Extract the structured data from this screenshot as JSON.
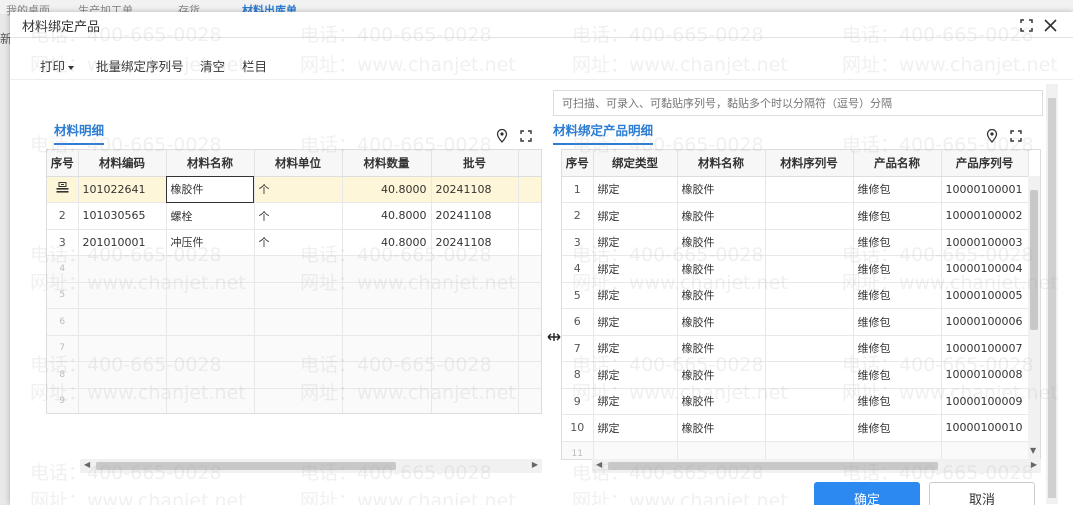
{
  "background": {
    "tabs": [
      "我的桌面",
      "生产加工单",
      "存货",
      "材料出库单"
    ],
    "edge_text": "新"
  },
  "dialog": {
    "title": "材料绑定产品",
    "icons": {
      "maximize": "maximize-icon",
      "close": "close-icon"
    }
  },
  "toolbar": {
    "print_label": "打印",
    "batch_bind_label": "批量绑定序列号",
    "clear_label": "清空",
    "columns_label": "栏目"
  },
  "scan": {
    "placeholder": "可扫描、可录入、可黏贴序列号，黏贴多个时以分隔符（逗号）分隔"
  },
  "left": {
    "title": "材料明细",
    "columns": [
      "序号",
      "材料编码",
      "材料名称",
      "材料单位",
      "材料数量",
      "批号"
    ],
    "rows": [
      [
        "",
        "101022641",
        "橡胶件",
        "个",
        "40.8000",
        "20241108"
      ],
      [
        "2",
        "101030565",
        "螺栓",
        "个",
        "40.8000",
        "20241108"
      ],
      [
        "3",
        "201010001",
        "冲压件",
        "个",
        "40.8000",
        "20241108"
      ]
    ],
    "empty_rows": [
      "4",
      "5",
      "6",
      "7",
      "8",
      "9"
    ]
  },
  "right": {
    "title": "材料绑定产品明细",
    "columns": [
      "序号",
      "绑定类型",
      "材料名称",
      "材料序列号",
      "产品名称",
      "产品序列号"
    ],
    "rows": [
      [
        "1",
        "绑定",
        "橡胶件",
        "",
        "维修包",
        "10000100001"
      ],
      [
        "2",
        "绑定",
        "橡胶件",
        "",
        "维修包",
        "10000100002"
      ],
      [
        "3",
        "绑定",
        "橡胶件",
        "",
        "维修包",
        "10000100003"
      ],
      [
        "4",
        "绑定",
        "橡胶件",
        "",
        "维修包",
        "10000100004"
      ],
      [
        "5",
        "绑定",
        "橡胶件",
        "",
        "维修包",
        "10000100005"
      ],
      [
        "6",
        "绑定",
        "橡胶件",
        "",
        "维修包",
        "10000100006"
      ],
      [
        "7",
        "绑定",
        "橡胶件",
        "",
        "维修包",
        "10000100007"
      ],
      [
        "8",
        "绑定",
        "橡胶件",
        "",
        "维修包",
        "10000100008"
      ],
      [
        "9",
        "绑定",
        "橡胶件",
        "",
        "维修包",
        "10000100009"
      ],
      [
        "10",
        "绑定",
        "橡胶件",
        "",
        "维修包",
        "10000100010"
      ]
    ],
    "empty_rows": [
      "11"
    ]
  },
  "buttons": {
    "confirm": "确定",
    "cancel": "取消"
  },
  "watermark": {
    "phone": "电话：400-665-0028",
    "site": "网址：www.chanjet.net"
  },
  "colors": {
    "accent": "#2d7dd2",
    "primary_button": "#2b89f0",
    "selected_row": "#fdf6d9"
  }
}
